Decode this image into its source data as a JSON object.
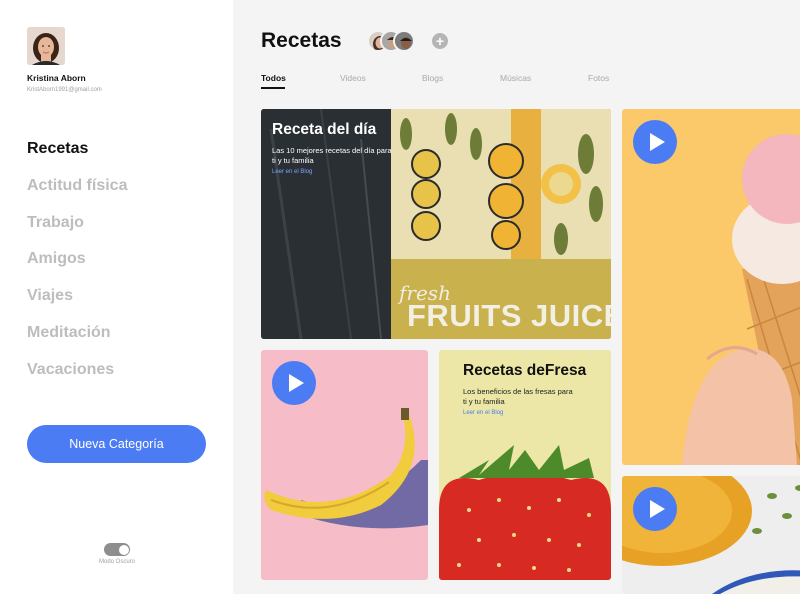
{
  "user": {
    "name": "Kristina Aborn",
    "email": "KristAborn1991@gmail.com"
  },
  "sidebar": {
    "items": [
      {
        "label": "Recetas"
      },
      {
        "label": "Actitud física"
      },
      {
        "label": "Trabajo"
      },
      {
        "label": "Amigos"
      },
      {
        "label": "Viajes"
      },
      {
        "label": "Meditación"
      },
      {
        "label": "Vacaciones"
      }
    ],
    "new_category_label": "Nueva Categoría",
    "dark_mode_label": "Modo Oscuro"
  },
  "header": {
    "title": "Recetas",
    "add_icon": "+"
  },
  "tabs": [
    {
      "label": "Todos"
    },
    {
      "label": "Videos"
    },
    {
      "label": "Blogs"
    },
    {
      "label": "Músicas"
    },
    {
      "label": "Fotos"
    }
  ],
  "cards": {
    "receta_dia": {
      "title": "Receta del día",
      "description": "Las 10 mejores recetas del día para ti y tu familia",
      "link": "Leer en el Blog",
      "image_text_1": "fresh",
      "image_text_2": "FRUITS JUICE"
    },
    "fresa": {
      "title": "Recetas deFresa",
      "description": "Los beneficios de las fresas para ti y tu familia",
      "link": "Leer en el Blog"
    }
  },
  "colors": {
    "accent": "#4b7cf3",
    "banana_bg": "#f6bcc8",
    "fresa_bg": "#ece7a6",
    "icecream_bg": "#fbc96a",
    "soup_bg": "#eeeeee"
  }
}
